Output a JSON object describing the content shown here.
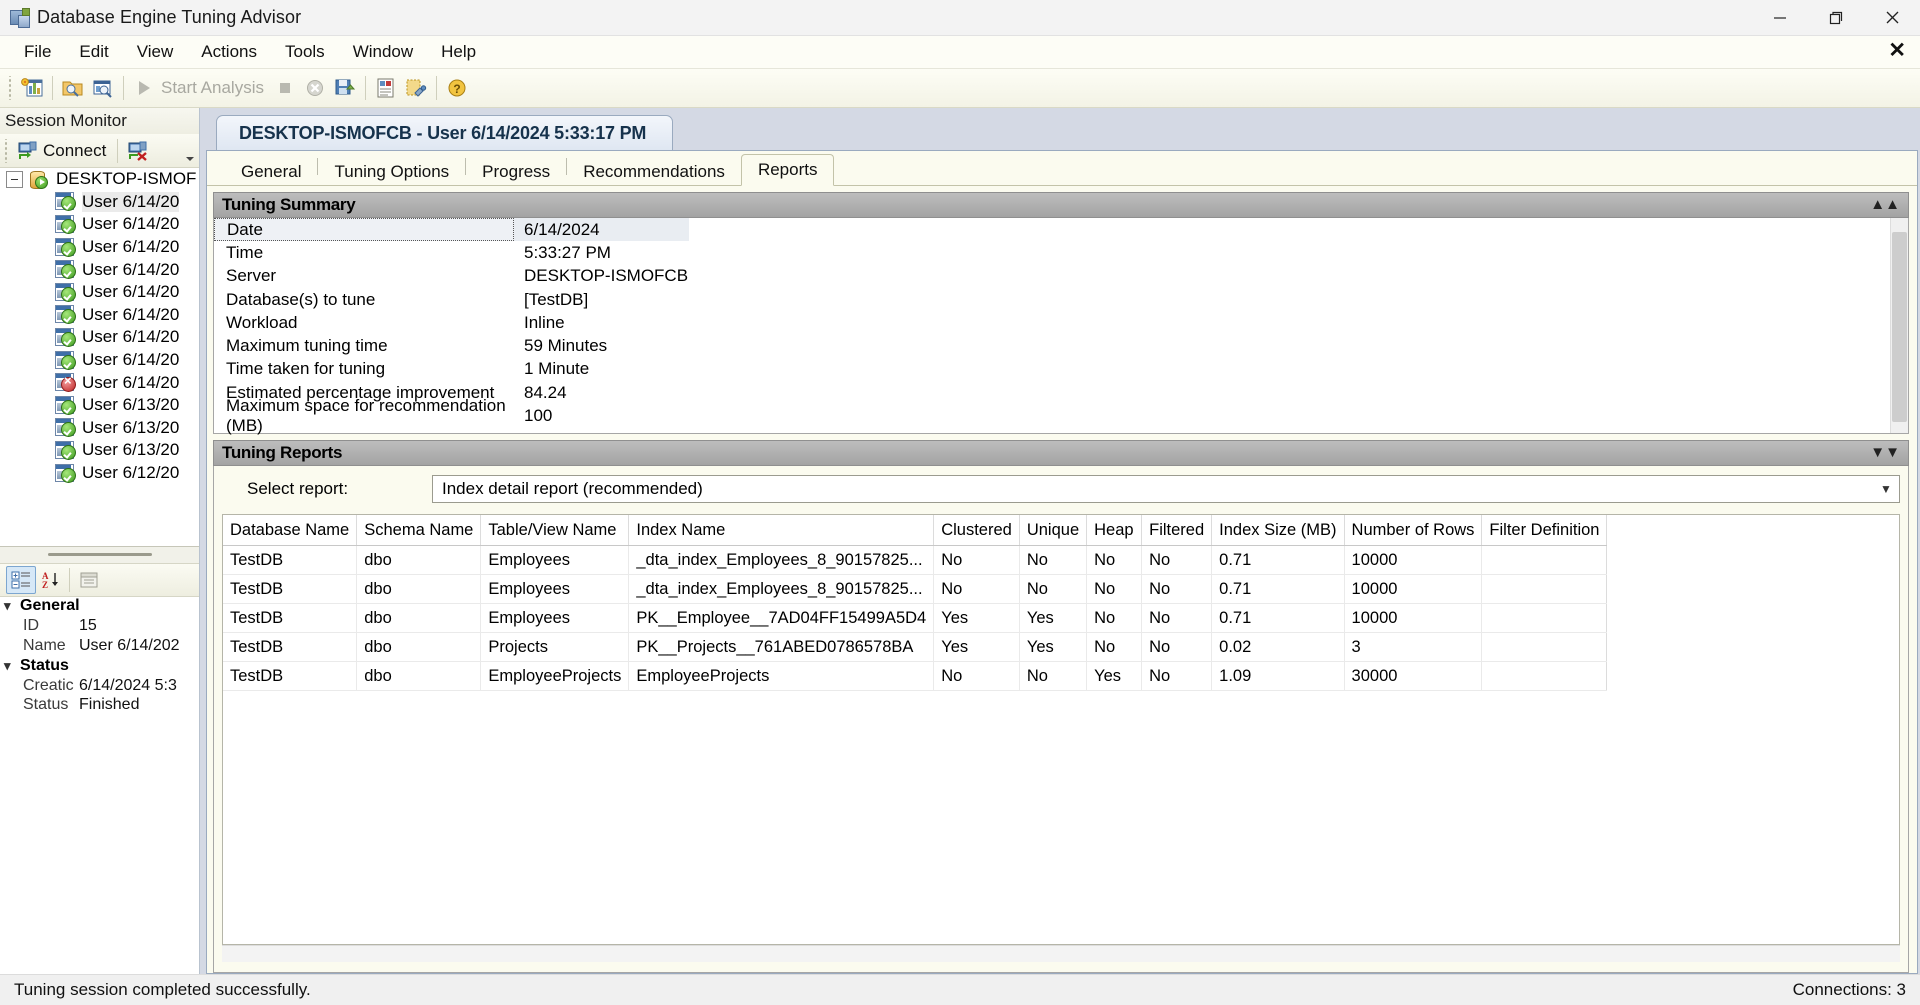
{
  "window": {
    "title": "Database Engine Tuning Advisor",
    "app_icon": "database-tuning-advisor-icon",
    "minimize": "minimize-icon",
    "maximize": "maximize-icon",
    "close": "close-icon"
  },
  "menubar": {
    "items": [
      "File",
      "Edit",
      "View",
      "Actions",
      "Tools",
      "Window",
      "Help"
    ],
    "close_document": "✕"
  },
  "toolbar": {
    "new_session_label": "new-session-icon",
    "open_label": "open-session-icon",
    "clone_label": "clone-session-icon",
    "start_analysis": "Start Analysis",
    "stop_label": "stop-icon",
    "stop_cancel_label": "stop-cancel-icon",
    "save_label": "save-icon",
    "report_label": "report-icon",
    "tune_label": "tune-icon",
    "help_label": "help-icon"
  },
  "session_monitor": {
    "dock_title": "Session Monitor",
    "connect_label": "Connect",
    "disconnect_label": "disconnect-icon",
    "server_node": "DESKTOP-ISMOF",
    "sessions": [
      {
        "label": "User 6/14/20",
        "status": "ok",
        "selected": true
      },
      {
        "label": "User 6/14/20",
        "status": "ok",
        "selected": false
      },
      {
        "label": "User 6/14/20",
        "status": "ok",
        "selected": false
      },
      {
        "label": "User 6/14/20",
        "status": "ok",
        "selected": false
      },
      {
        "label": "User 6/14/20",
        "status": "ok",
        "selected": false
      },
      {
        "label": "User 6/14/20",
        "status": "ok",
        "selected": false
      },
      {
        "label": "User 6/14/20",
        "status": "ok",
        "selected": false
      },
      {
        "label": "User 6/14/20",
        "status": "ok",
        "selected": false
      },
      {
        "label": "User 6/14/20",
        "status": "error",
        "selected": false
      },
      {
        "label": "User 6/13/20",
        "status": "ok",
        "selected": false
      },
      {
        "label": "User 6/13/20",
        "status": "ok",
        "selected": false
      },
      {
        "label": "User 6/13/20",
        "status": "ok",
        "selected": false
      },
      {
        "label": "User 6/12/20",
        "status": "ok",
        "selected": false
      }
    ]
  },
  "properties": {
    "toolbar": {
      "categorized": "categorized-icon",
      "alphabetical": "sort-alphabetical-icon",
      "property_pages": "property-pages-icon"
    },
    "groups": [
      {
        "name": "General",
        "rows": [
          {
            "key": "ID",
            "value": "15"
          },
          {
            "key": "Name",
            "value": "User 6/14/202"
          }
        ]
      },
      {
        "name": "Status",
        "rows": [
          {
            "key": "Creatic",
            "value": "6/14/2024 5:3"
          },
          {
            "key": "Status",
            "value": "Finished"
          }
        ]
      }
    ]
  },
  "document": {
    "tab_title": "DESKTOP-ISMOFCB - User 6/14/2024 5:33:17 PM",
    "page_tabs": [
      {
        "label": "General",
        "active": false
      },
      {
        "label": "Tuning Options",
        "active": false
      },
      {
        "label": "Progress",
        "active": false
      },
      {
        "label": "Recommendations",
        "active": false
      },
      {
        "label": "Reports",
        "active": true
      }
    ]
  },
  "tuning_summary": {
    "header": "Tuning Summary",
    "collapse_icon": "chevron-up-icon",
    "rows": [
      {
        "key": "Date",
        "value": "6/14/2024",
        "selected": true
      },
      {
        "key": "Time",
        "value": "5:33:27 PM",
        "selected": false
      },
      {
        "key": "Server",
        "value": "DESKTOP-ISMOFCB",
        "selected": false
      },
      {
        "key": "Database(s) to tune",
        "value": "[TestDB]",
        "selected": false
      },
      {
        "key": "Workload",
        "value": "Inline",
        "selected": false
      },
      {
        "key": "Maximum tuning time",
        "value": "59 Minutes",
        "selected": false
      },
      {
        "key": "Time taken for tuning",
        "value": "1 Minute",
        "selected": false
      },
      {
        "key": "Estimated percentage improvement",
        "value": "84.24",
        "selected": false
      },
      {
        "key": "Maximum space for recommendation (MB)",
        "value": "100",
        "selected": false
      }
    ]
  },
  "tuning_reports": {
    "header": "Tuning Reports",
    "expand_icon": "chevron-down-icon",
    "select_label": "Select report:",
    "selected_report": "Index detail report (recommended)",
    "dropdown_icon": "chevron-down-icon",
    "columns": [
      "Database Name",
      "Schema Name",
      "Table/View Name",
      "Index Name",
      "Clustered",
      "Unique",
      "Heap",
      "Filtered",
      "Index Size (MB)",
      "Number of Rows",
      "Filter Definition"
    ],
    "rows": [
      [
        "TestDB",
        "dbo",
        "Employees",
        "_dta_index_Employees_8_90157825...",
        "No",
        "No",
        "No",
        "No",
        "0.71",
        "10000",
        ""
      ],
      [
        "TestDB",
        "dbo",
        "Employees",
        "_dta_index_Employees_8_90157825...",
        "No",
        "No",
        "No",
        "No",
        "0.71",
        "10000",
        ""
      ],
      [
        "TestDB",
        "dbo",
        "Employees",
        "PK__Employee__7AD04FF15499A5D4",
        "Yes",
        "Yes",
        "No",
        "No",
        "0.71",
        "10000",
        ""
      ],
      [
        "TestDB",
        "dbo",
        "Projects",
        "PK__Projects__761ABED0786578BA",
        "Yes",
        "Yes",
        "No",
        "No",
        "0.02",
        "3",
        ""
      ],
      [
        "TestDB",
        "dbo",
        "EmployeeProjects",
        "EmployeeProjects",
        "No",
        "No",
        "Yes",
        "No",
        "1.09",
        "30000",
        ""
      ]
    ]
  },
  "statusbar": {
    "message": "Tuning session completed successfully.",
    "connections": "Connections: 3"
  }
}
